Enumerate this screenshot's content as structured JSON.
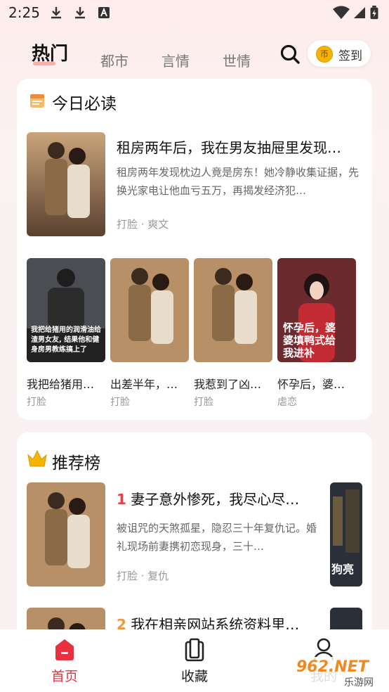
{
  "status_bar": {
    "time": "2:25"
  },
  "tabs": [
    {
      "label": "热门",
      "active": true
    },
    {
      "label": "都市",
      "active": false
    },
    {
      "label": "言情",
      "active": false
    },
    {
      "label": "世情",
      "active": false
    }
  ],
  "checkin": {
    "label": "签到"
  },
  "daily": {
    "title": "今日必读",
    "featured": {
      "title": "租房两年后，我在男友抽屉里发现…",
      "desc": "租房两年发现枕边人竟是房东！她冷静收集证据，先换光家电让他血亏五万，再揭发经济犯…",
      "tags": "打脸 · 爽文"
    },
    "grid": [
      {
        "title": "我把给猪用…",
        "tag": "打脸",
        "cover_text": "我把给猪用的润滑油给渣男女友, 结果他和健身房男教练搞上了"
      },
      {
        "title": "出差半年，…",
        "tag": "打脸",
        "cover_text": ""
      },
      {
        "title": "我惹到了凶…",
        "tag": "打脸",
        "cover_text": ""
      },
      {
        "title": "怀孕后，婆…",
        "tag": "虐恋",
        "cover_text": "怀孕后，婆婆填鸭式给我进补"
      }
    ]
  },
  "ranking": {
    "title": "推荐榜",
    "items": [
      {
        "rank": "1",
        "title": "妻子意外惨死，我尽心尽…",
        "desc": "被诅咒的天煞孤星，隐忍三十年复仇记。婚礼现场前妻携初恋现身，三十…",
        "tags": "打脸 · 复仇",
        "side_cover_text": "狗亮"
      },
      {
        "rank": "2",
        "title": "我在相亲网站系统资料里…"
      }
    ]
  },
  "bottom_nav": [
    {
      "label": "首页",
      "active": true
    },
    {
      "label": "收藏",
      "active": false
    },
    {
      "label": "我的",
      "active": false
    }
  ],
  "watermark": {
    "text": "962.NET",
    "sub": "乐游网"
  },
  "colors": {
    "accent": "#e8303f",
    "rank_1": "#e8404a",
    "rank_2": "#f0983a",
    "coin": "#f5b400"
  }
}
